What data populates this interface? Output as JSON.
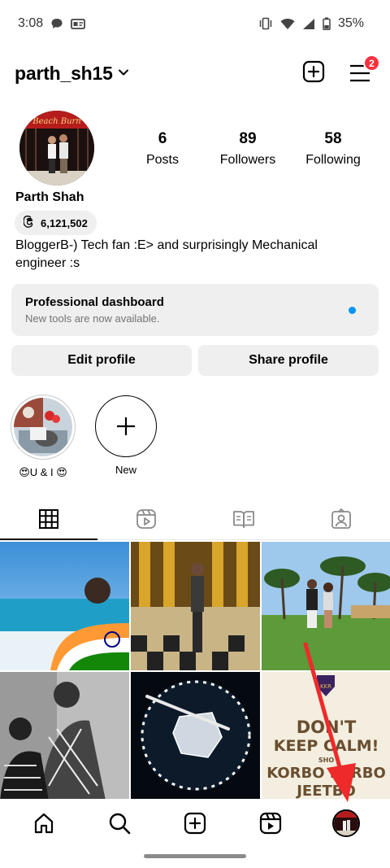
{
  "status_bar": {
    "time": "3:08",
    "battery": "35%",
    "left_icons": [
      "chat-bubble-icon",
      "id-card-icon"
    ],
    "right_icons": [
      "vibrate-icon",
      "wifi-icon",
      "signal-icon",
      "battery-icon"
    ]
  },
  "header": {
    "username": "parth_sh15",
    "notification_count": "2",
    "icons": [
      "chevron-down-icon",
      "add-post-icon",
      "menu-icon"
    ]
  },
  "profile": {
    "stats": [
      {
        "value": "6",
        "label": "Posts"
      },
      {
        "value": "89",
        "label": "Followers"
      },
      {
        "value": "58",
        "label": "Following"
      }
    ],
    "display_name": "Parth Shah",
    "threads_count": "6,121,502",
    "bio": "BloggerB-) Tech fan :E> and surprisingly Mechanical engineer :s"
  },
  "dashboard": {
    "title": "Professional dashboard",
    "subtitle": "New tools are now available.",
    "dot_color": "#0095f6"
  },
  "buttons": {
    "edit": "Edit profile",
    "share": "Share profile"
  },
  "highlights": [
    {
      "label": "😍U & I 😍"
    },
    {
      "label": "New"
    }
  ],
  "tabs": [
    "grid-icon",
    "reels-icon",
    "guides-icon",
    "tagged-icon"
  ],
  "posts": {
    "poster_text": [
      "DON'T",
      "KEEP CALM!",
      "SHO",
      "KORBO LORBO",
      "JEETBO"
    ]
  },
  "bottom_nav": [
    "home-icon",
    "search-icon",
    "create-icon",
    "reels-icon",
    "profile-avatar"
  ],
  "annotation_color": "#ee2a2a"
}
